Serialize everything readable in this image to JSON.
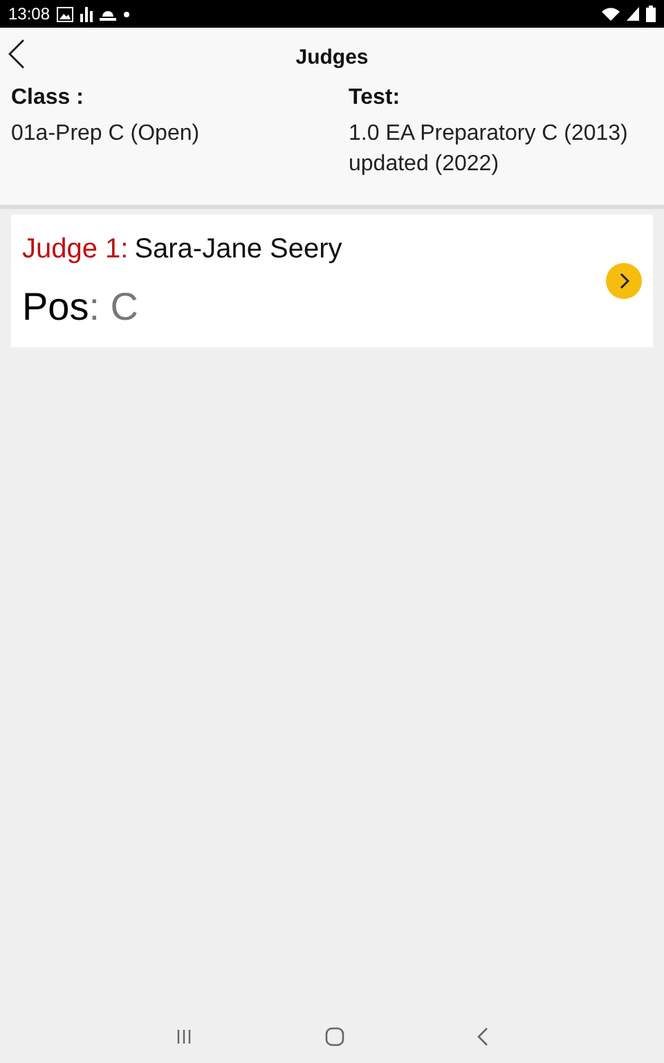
{
  "status_bar": {
    "time": "13:08"
  },
  "header": {
    "title": "Judges"
  },
  "info": [
    {
      "label": "Class :",
      "value": "01a-Prep C (Open)"
    },
    {
      "label": "Test:",
      "value": "1.0 EA Preparatory C (2013) updated (2022)"
    }
  ],
  "judges": [
    {
      "label": "Judge 1:",
      "name": "Sara-Jane Seery",
      "pos_label": "Pos",
      "pos_value": ": C"
    }
  ]
}
